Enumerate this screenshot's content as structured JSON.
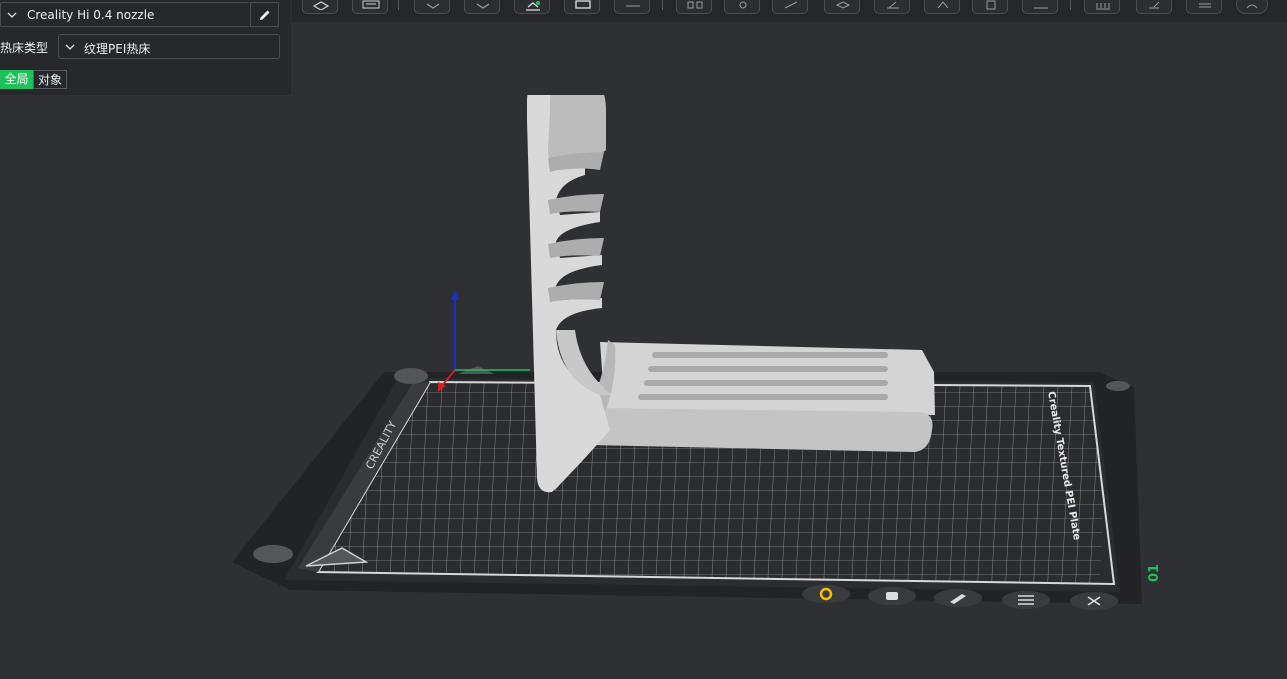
{
  "printer": {
    "name": "Creality Hi 0.4 nozzle"
  },
  "bed": {
    "label": "热床类型",
    "value": "纹理PEI热床"
  },
  "scope_tabs": {
    "global": "全局",
    "object": "对象",
    "active": "global"
  },
  "plate": {
    "brand_left": "CREALITY",
    "brand_right": "Creality Textured PEI Plate",
    "plate_number": "01"
  },
  "toolbar_icons": [
    "view-cube-icon",
    "keyboard-icon",
    "add-part-icon",
    "shape-icon",
    "auto-orient-icon",
    "arrange-icon",
    "layout-icon",
    "split-objects-icon",
    "settings-gear-icon",
    "measure-icon",
    "layer-icon",
    "cut-icon",
    "support-icon",
    "seam-icon",
    "mirror-icon",
    "text-icon",
    "assembly-icon",
    "slice-view-icon",
    "edit-icon",
    "preview-icon",
    "help-icon"
  ],
  "plate_buttons": [
    "select-plate-icon",
    "lock-plate-icon",
    "edit-plate-icon",
    "arrange-plate-icon",
    "delete-plate-icon"
  ],
  "colors": {
    "accent": "#1fc15a",
    "background": "#2f3034",
    "panel": "#27282b"
  }
}
